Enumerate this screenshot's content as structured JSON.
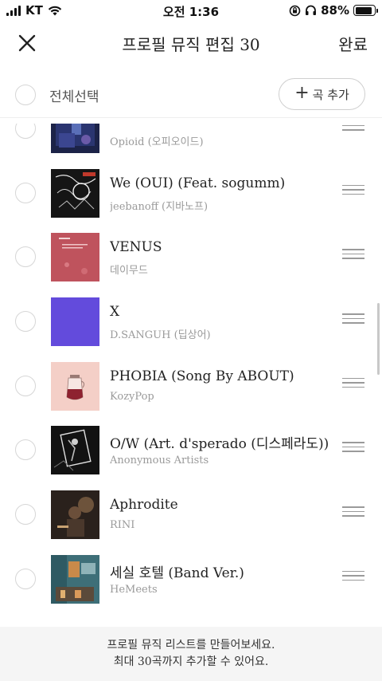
{
  "status_bar": {
    "carrier": "KT",
    "time": "오전 1:36",
    "battery_percent": "88%",
    "battery_level": 0.88
  },
  "header": {
    "title": "프로필 뮤직 편집 30",
    "done_label": "완료",
    "close_icon": "close-icon"
  },
  "select_bar": {
    "select_all_label": "전체선택",
    "add_label": "곡 추가",
    "add_icon": "+"
  },
  "songs": [
    {
      "title": "",
      "artist": "Opioid (오피오이드)"
    },
    {
      "title": "We (OUI) (Feat. sogumm)",
      "artist": "jeebanoff (지바노프)"
    },
    {
      "title": "VENUS",
      "artist": "데이무드"
    },
    {
      "title": "X",
      "artist": "D.SANGUH (딥상어)"
    },
    {
      "title": "PHOBIA (Song By ABOUT)",
      "artist": "KozyPop"
    },
    {
      "title": "O/W (Art. d'sperado (디스페라도))",
      "artist": "Anonymous Artists"
    },
    {
      "title": "Aphrodite",
      "artist": "RINI"
    },
    {
      "title": "세실 호텔 (Band Ver.)",
      "artist": "HeMeets"
    }
  ],
  "footer": {
    "line1": "프로필 뮤직 리스트를 만들어보세요.",
    "line2": "최대 30곡까지 추가할 수 있어요."
  },
  "colors": {
    "accent_text": "#222222",
    "muted_text": "#9a9a9a",
    "footer_bg": "#f5f5f5"
  }
}
